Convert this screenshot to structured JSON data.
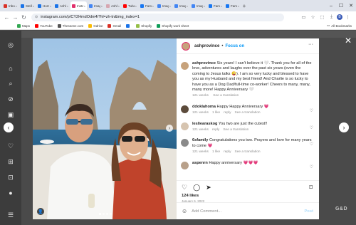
{
  "browser": {
    "tabs": [
      {
        "label": "Inbox",
        "color": "#d93025"
      },
      {
        "label": "Stellr",
        "color": "#1a73e8"
      },
      {
        "label": "Home",
        "color": "#1a73e8"
      },
      {
        "label": "Ashle",
        "color": "#1a73e8"
      },
      {
        "label": "Insta",
        "color": "#e1306c",
        "active": true
      },
      {
        "label": "Imag",
        "color": "#4285f4"
      },
      {
        "label": "Ashl",
        "color": "#d6a6b1"
      },
      {
        "label": "Tube",
        "color": "#ff0000"
      },
      {
        "label": "Fami",
        "color": "#1877f2"
      },
      {
        "label": "Imag",
        "color": "#4285f4"
      },
      {
        "label": "Imag",
        "color": "#4285f4"
      },
      {
        "label": "Imag",
        "color": "#4285f4"
      },
      {
        "label": "Fami",
        "color": "#1877f2"
      },
      {
        "label": "Fami",
        "color": "#1877f2"
      }
    ],
    "url": "instagram.com/p/CY2HmdOdm4/?hl=zh-tn&img_index=1",
    "bookmarks": [
      {
        "label": "Maps",
        "color": "#34a853"
      },
      {
        "label": "YouTube",
        "color": "#ff0000"
      },
      {
        "label": "Theseenz.com",
        "color": "#555555"
      },
      {
        "label": "Gdrive",
        "color": "#fbbc04"
      },
      {
        "label": "Gmail",
        "color": "#d93025"
      },
      {
        "label": "",
        "color": "#1a73e8"
      },
      {
        "label": "Shopify",
        "color": "#95bf47"
      },
      {
        "label": "Shopify work sheet",
        "color": "#0f9d58"
      }
    ],
    "all_bookmarks": "All Bookmarks"
  },
  "post": {
    "username": "ashprovince",
    "follow": "Focus on",
    "caption_user": "ashprovince",
    "caption": "Six years! I can't believe it 🤍. Thank you for all of the love, adventures and laughs over the past six years (even the coming to Jesus talks 😜). I am so very lucky and blessed to have you as my Husband and my best friend! And Charlie is so lucky to have you as a Dog Dad/full-time co-worker! Cheers to many, many, many more! Happy Anniversary 🤍",
    "caption_time": "121 weeks",
    "caption_translate": "See a translation",
    "comments": [
      {
        "user": "ddoklahoma",
        "text": "Happy Happy Anniversary 💗",
        "time": "121 weeks",
        "likes": "1 like",
        "reply": "reply",
        "translate": "See a translation",
        "color": "#5c4b3b"
      },
      {
        "user": "lesliearaskog",
        "text": "You two are just the cutest!!",
        "time": "121 weeks",
        "likes": "",
        "reply": "reply",
        "translate": "See a translation",
        "color": "#d6c4b0"
      },
      {
        "user": "6sfamily",
        "text": "Congratulations you two. Prayers and love for many years to come 💗",
        "time": "121 weeks",
        "likes": "1 like",
        "reply": "reply",
        "translate": "See a translation",
        "color": "#8a8a8a"
      },
      {
        "user": "aspenrn",
        "text": "Happy anniversary 💗💗💗",
        "time": "",
        "likes": "",
        "reply": "",
        "translate": "",
        "color": "#b8a08a"
      }
    ],
    "likes": "124 likes",
    "date": "January 6, 2022",
    "add_comment": "Add Comment...",
    "post_button": "Post",
    "watermark": "G&D"
  },
  "colors": {
    "accent": "#0095f6",
    "heart": "#e1306c"
  }
}
